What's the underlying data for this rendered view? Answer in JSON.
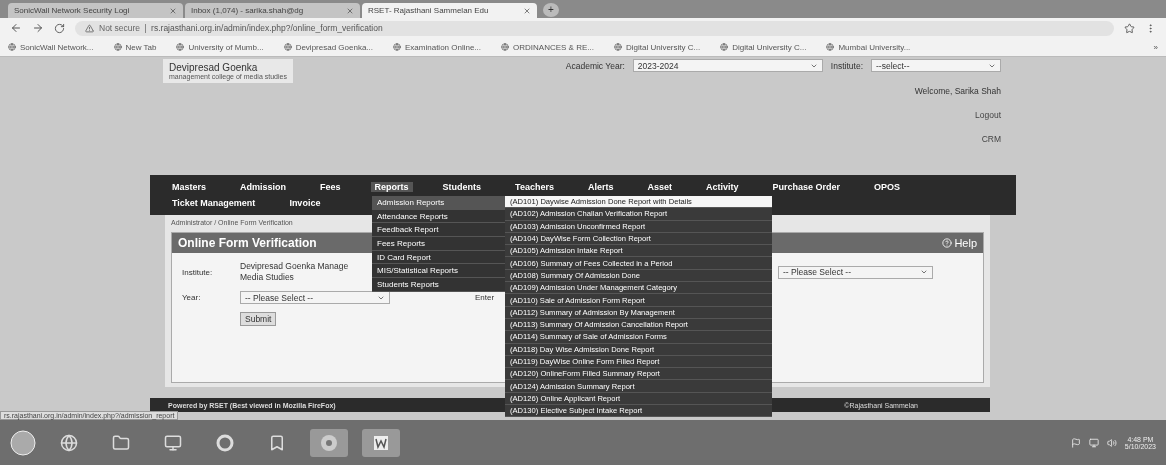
{
  "browser": {
    "tabs": [
      {
        "title": "SonicWall Network Security Logi",
        "selected": false
      },
      {
        "title": "Inbox (1,074) - sarika.shah@dg",
        "selected": false
      },
      {
        "title": "RSET- Rajasthani Sammelan Edu",
        "selected": true
      }
    ],
    "new_tab": "+",
    "security": "Not secure",
    "url": "rs.rajasthani.org.in/admin/index.php?/online_form_verification",
    "bookmarks": [
      "SonicWall Network...",
      "New Tab",
      "University of Mumb...",
      "Devipresad Goenka...",
      "Examination Online...",
      "ORDINANCES & RE...",
      "Digital University C...",
      "Digital University C...",
      "Mumbai University..."
    ],
    "more_bookmarks": "»",
    "status_url": "rs.rajasthani.org.in/admin/index.php?/admission_report"
  },
  "header": {
    "logo_title": "Devipresad Goenka",
    "logo_subtitle": "management college of media studies",
    "academic_year_label": "Academic Year:",
    "academic_year": "2023-2024",
    "institute_label": "Institute:",
    "institute": "--select--",
    "welcome": "Welcome, Sarika Shah",
    "logout": "Logout",
    "crm": "CRM"
  },
  "nav": {
    "rows": [
      [
        {
          "label": "Masters",
          "selected": false
        },
        {
          "label": "Admission",
          "selected": false
        },
        {
          "label": "Fees",
          "selected": false
        },
        {
          "label": "Reports",
          "selected": true
        },
        {
          "label": "Students",
          "selected": false
        },
        {
          "label": "Teachers",
          "selected": false
        },
        {
          "label": "Alerts",
          "selected": false
        },
        {
          "label": "Asset",
          "selected": false
        },
        {
          "label": "Activity",
          "selected": false
        },
        {
          "label": "Purchase Order",
          "selected": false
        },
        {
          "label": "OPOS",
          "selected": false
        }
      ],
      [
        {
          "label": "Ticket Management",
          "selected": false
        },
        {
          "label": "Invoice",
          "selected": false
        }
      ]
    ]
  },
  "dropdown": {
    "categories": [
      {
        "label": "Admission Reports",
        "selected": true
      },
      {
        "label": "Attendance Reports",
        "selected": false
      },
      {
        "label": "Feedback Report",
        "selected": false
      },
      {
        "label": "Fees Reports",
        "selected": false
      },
      {
        "label": "ID Card Report",
        "selected": false
      },
      {
        "label": "MIS/Statistical Reports",
        "selected": false
      },
      {
        "label": "Students Reports",
        "selected": false
      }
    ],
    "reports": [
      {
        "label": "(AD101) Daywise Admission Done Report with Details",
        "selected": true
      },
      {
        "label": "(AD102) Admission Challan Verification Report",
        "selected": false
      },
      {
        "label": "(AD103) Admission Unconfirmed Report",
        "selected": false
      },
      {
        "label": "(AD104) DayWise Form Collection Report",
        "selected": false
      },
      {
        "label": "(AD105) Admission Intake Report",
        "selected": false
      },
      {
        "label": "(AD106) Summary of Fees Collected in a Period",
        "selected": false
      },
      {
        "label": "(AD108) Summary Of Admission Done",
        "selected": false
      },
      {
        "label": "(AD109) Admission Under Management Category",
        "selected": false
      },
      {
        "label": "(AD110) Sale of Admission Form Report",
        "selected": false
      },
      {
        "label": "(AD112) Summary of Admission By Management",
        "selected": false
      },
      {
        "label": "(AD113) Summary Of Admission Cancellation Report",
        "selected": false
      },
      {
        "label": "(AD114) Summary of Sale of Admission Forms",
        "selected": false
      },
      {
        "label": "(AD118) Day Wise Admission Done Report",
        "selected": false
      },
      {
        "label": "(AD119) DayWise Online Form Filled Report",
        "selected": false
      },
      {
        "label": "(AD120) OnlineForm Filled Summary Report",
        "selected": false
      },
      {
        "label": "(AD124) Admission Summary Report",
        "selected": false
      },
      {
        "label": "(AD126) Online Applicant Report",
        "selected": false
      },
      {
        "label": "(AD130) Elective Subject Intake Report",
        "selected": false
      }
    ]
  },
  "breadcrumb": "Administrator / Online Form Verification",
  "panel": {
    "title": "Online Form Verification",
    "help": "Help",
    "institute_label": "Institute:",
    "institute_lines": [
      "Devipresad Goenka Manage",
      "Media Studies"
    ],
    "right_select": "-- Please Select --",
    "year_label": "Year:",
    "year_select": "-- Please Select --",
    "enter_label": "Enter",
    "submit": "Submit"
  },
  "footer": {
    "powered": "Powered by RSET (Best viewed in Mozilla FireFox)",
    "copyright": "©Rajasthani Sammelan"
  },
  "taskbar": {
    "time": "4:48 PM",
    "date": "5/10/2023"
  }
}
